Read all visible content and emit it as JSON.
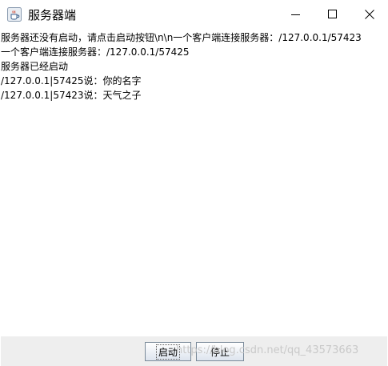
{
  "window": {
    "title": "服务器端",
    "icon": "java-cup-icon"
  },
  "log": {
    "lines": [
      "服务器还没有启动，请点击启动按钮\\n\\n一个客户端连接服务器：/127.0.0.1/57423",
      "一个客户端连接服务器：/127.0.0.1/57425",
      "服务器已经启动",
      "/127.0.0.1|57425说：你的名字",
      "/127.0.0.1|57423说：天气之子"
    ]
  },
  "buttons": {
    "start_label": "启动",
    "stop_label": "停止"
  },
  "watermark": "https://blog.csdn.net/qq_43573663"
}
